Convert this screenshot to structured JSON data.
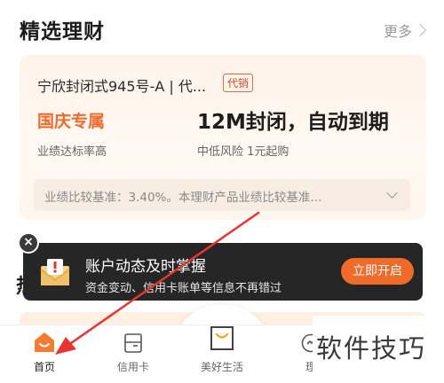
{
  "section": {
    "title": "精选理财",
    "more_label": "更多"
  },
  "product": {
    "name": "宁欣封闭式945号-A | 代...",
    "tag": "代销",
    "promo_label": "国庆专属",
    "promo_sub": "业绩达标率高",
    "headline": "12M封闭，自动到期",
    "headline_sub": "中低风险  1元起购",
    "benchmark_text": "业绩比较基准：3.40%。本理财产品业绩比较基准..."
  },
  "notify": {
    "close_symbol": "×",
    "title": "账户动态及时掌握",
    "description": "资金变动、信用卡账单等信息不再错过",
    "button_label": "立即开启"
  },
  "partial_heading": "热",
  "tabbar": {
    "items": [
      {
        "label": "首页",
        "icon": "home-icon",
        "active": true
      },
      {
        "label": "信用卡",
        "icon": "credit-card-icon",
        "active": false
      },
      {
        "label": "美好生活",
        "icon": "shopping-bag-icon",
        "active": false
      },
      {
        "label": "理",
        "icon": "wealth-icon",
        "active": false
      }
    ]
  },
  "watermark": "软件技巧",
  "colors": {
    "accent": "#f06a2a",
    "banner_bg": "#262626",
    "card_bg": "#fff3e9",
    "arrow": "#e8342e"
  }
}
